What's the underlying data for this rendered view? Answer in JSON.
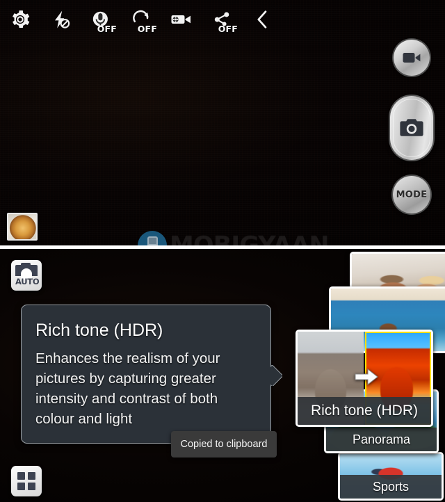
{
  "app": {
    "name": "Camera",
    "watermark_text": "MOBIGYAAN"
  },
  "viewfinder": {
    "toolbar": [
      {
        "id": "settings",
        "icon": "gear-icon",
        "label": "Settings",
        "state": ""
      },
      {
        "id": "flash",
        "icon": "flash-off-icon",
        "label": "Flash",
        "state": "off"
      },
      {
        "id": "voice-control",
        "icon": "voice-control-icon",
        "label": "Voice control",
        "state": "OFF"
      },
      {
        "id": "timer",
        "icon": "timer-icon",
        "label": "Timer",
        "state": "OFF"
      },
      {
        "id": "recording-mode",
        "icon": "video-camera-icon",
        "label": "Recording mode",
        "state": ""
      },
      {
        "id": "share",
        "icon": "share-icon",
        "label": "Share shot",
        "state": "OFF"
      },
      {
        "id": "collapse",
        "icon": "chevron-left-icon",
        "label": "Collapse",
        "state": ""
      }
    ],
    "controls": {
      "record_label": "Record video",
      "shutter_label": "Capture photo",
      "mode_label": "MODE"
    },
    "thumbnail": {
      "label": "Last photo",
      "subject": "pizza"
    }
  },
  "mode_chooser": {
    "auto_button": {
      "icon": "auto-camera-icon",
      "label": "AUTO"
    },
    "grid_button": {
      "icon": "grid-2x2-icon",
      "label": "All modes"
    },
    "tooltip": {
      "title": "Rich tone (HDR)",
      "description": "Enhances the realism of your pictures by capturing greater intensity and contrast of both colour and light"
    },
    "toast": {
      "text": "Copied to clipboard"
    },
    "cards": [
      {
        "id": "best-face",
        "label": "",
        "subject": "couple-in-bed",
        "selected": false,
        "label_visible": false
      },
      {
        "id": "sound-shot",
        "label": "",
        "subject": "child-at-sea",
        "selected": false,
        "label_visible": false
      },
      {
        "id": "rich-tone",
        "label": "Rich tone (HDR)",
        "subject": "horseshoe-bend",
        "selected": true,
        "label_visible": true
      },
      {
        "id": "panorama",
        "label": "Panorama",
        "subject": "coastal-panorama",
        "selected": false,
        "label_visible": true
      },
      {
        "id": "sports",
        "label": "Sports",
        "subject": "surfer",
        "selected": false,
        "label_visible": true
      }
    ]
  },
  "colors": {
    "background": "#000000",
    "tooltip_bg": "#2b3138",
    "tooltip_border": "#9aa0a6",
    "toast_bg": "#3a3a3a",
    "selection_frame": "#e8d23a",
    "divider": "#ffffff",
    "watermark_badge": "#1e6a96"
  }
}
